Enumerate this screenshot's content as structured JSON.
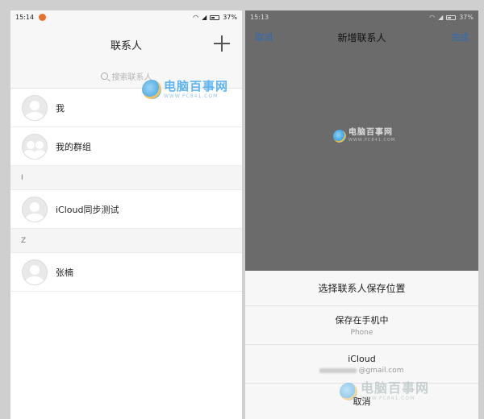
{
  "left_screen": {
    "status_bar": {
      "time": "15:14",
      "battery": "37%"
    },
    "nav": {
      "title": "联系人",
      "add_icon": "plus-icon"
    },
    "search": {
      "placeholder": "搜索联系人"
    },
    "contacts_top": [
      {
        "name": "我",
        "avatar": "person-avatar-icon"
      },
      {
        "name": "我的群组",
        "avatar": "group-avatar-icon"
      }
    ],
    "sections": [
      {
        "letter": "I",
        "contacts": [
          {
            "name": "iCloud同步测试"
          }
        ]
      },
      {
        "letter": "Z",
        "contacts": [
          {
            "name": "张楠"
          }
        ]
      }
    ]
  },
  "right_screen": {
    "status_bar": {
      "time": "15:13",
      "battery": "37%"
    },
    "nav": {
      "cancel": "取消",
      "title": "新增联系人",
      "done": "完成"
    },
    "sheet": {
      "title": "选择联系人保存位置",
      "options": [
        {
          "main": "保存在手机中",
          "sub": "Phone"
        },
        {
          "main": "iCloud",
          "sub": "@gmail.com"
        }
      ],
      "cancel": "取消"
    }
  },
  "watermark": {
    "title": "电脑百事网",
    "subtitle": "WWW.PC841.COM"
  },
  "colors": {
    "link_blue": "#2a6db8",
    "overlay_gray": "#6b6b6b",
    "notif_orange": "#e8702a"
  }
}
